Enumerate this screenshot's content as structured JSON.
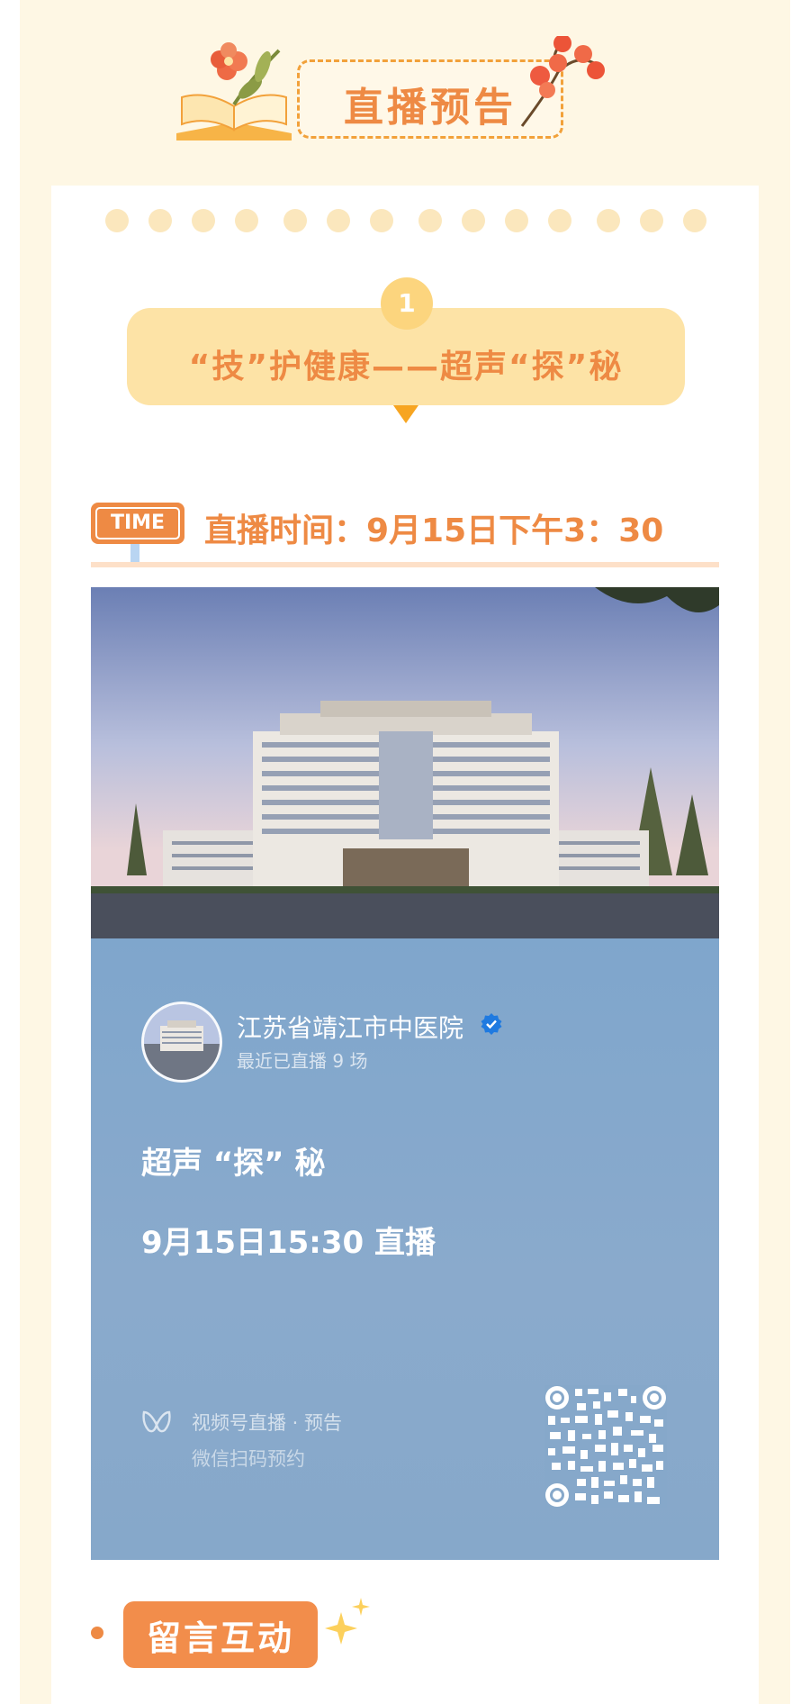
{
  "header": {
    "title": "直播预告"
  },
  "topic": {
    "number": "1",
    "title": "“技”护健康——超声“探”秘"
  },
  "schedule": {
    "tag": "TIME",
    "text": "直播时间：9月15日下午3：30"
  },
  "poster": {
    "account_name": "江苏省靖江市中医院",
    "account_sub": "最近已直播 9 场",
    "live_title": "超声 “探” 秘",
    "live_time": "9月15日15:30 直播",
    "channels_label": "视频号直播 · 预告",
    "channels_sub": "微信扫码预约"
  },
  "comment": {
    "label": "留言互动"
  },
  "icons": {
    "verified": "verified-badge-icon",
    "channels": "wechat-channels-icon",
    "qr": "qr-code-icon",
    "sparkle": "sparkle-icon"
  },
  "colors": {
    "accent": "#ee8a44",
    "topic_bg": "#fde3a6",
    "badge": "#fcd57e",
    "page_bg": "#fef7e4",
    "poster_blue": "#86a8ca"
  }
}
